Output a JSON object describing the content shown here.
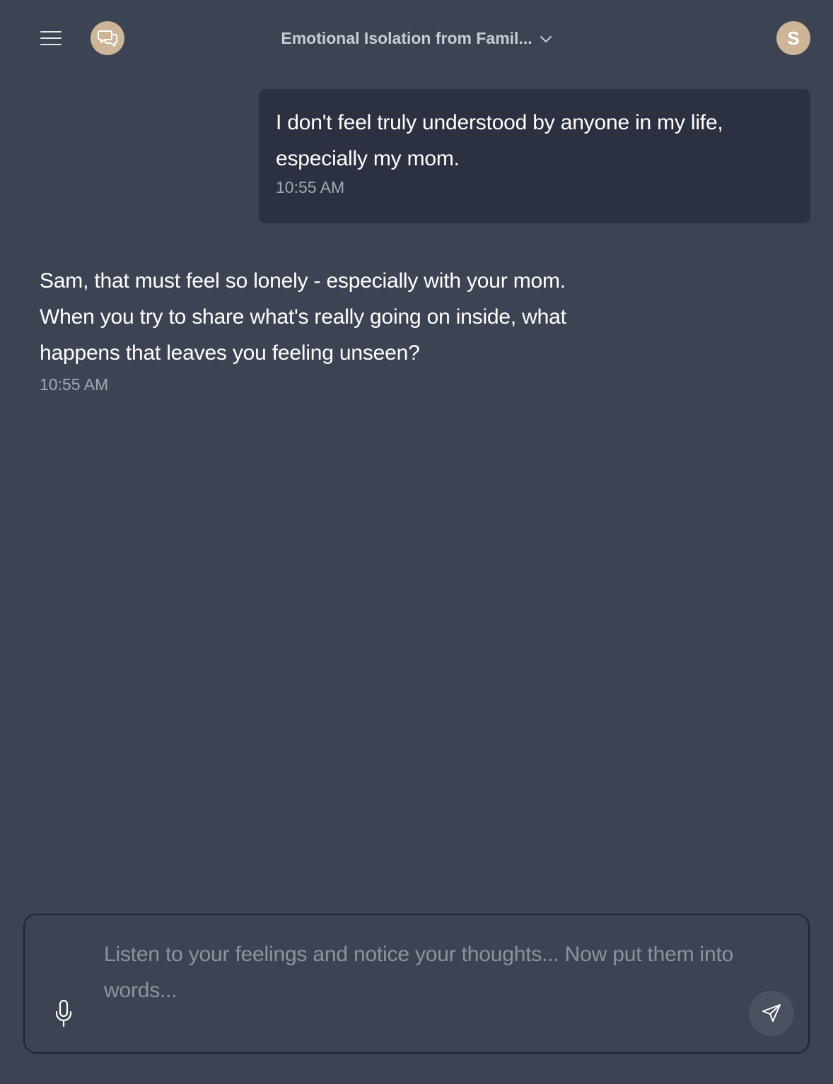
{
  "header": {
    "menu_icon": "hamburger-menu-icon",
    "logo_icon": "chat-bubbles-icon",
    "conversation_title": "Emotional Isolation from Famil...",
    "title_dropdown_icon": "chevron-down-icon",
    "avatar_initial": "S"
  },
  "messages": [
    {
      "role": "user",
      "text": "I don't feel truly understood by anyone in my life, especially my mom.",
      "time": "10:55 AM"
    },
    {
      "role": "assistant",
      "text": "Sam, that must feel so lonely - especially with your mom. When you try to share what's really going on inside, what happens that leaves you feeling unseen?",
      "time": "10:55 AM"
    }
  ],
  "composer": {
    "placeholder": "Listen to your feelings and notice your thoughts... Now put them into words...",
    "value": "",
    "mic_icon": "microphone-icon",
    "send_icon": "send-icon"
  },
  "colors": {
    "background": "#3c4353",
    "user_bubble": "#2b3140",
    "accent": "#cdb597",
    "timestamp": "#a3a9b4",
    "placeholder": "#8d939e"
  }
}
